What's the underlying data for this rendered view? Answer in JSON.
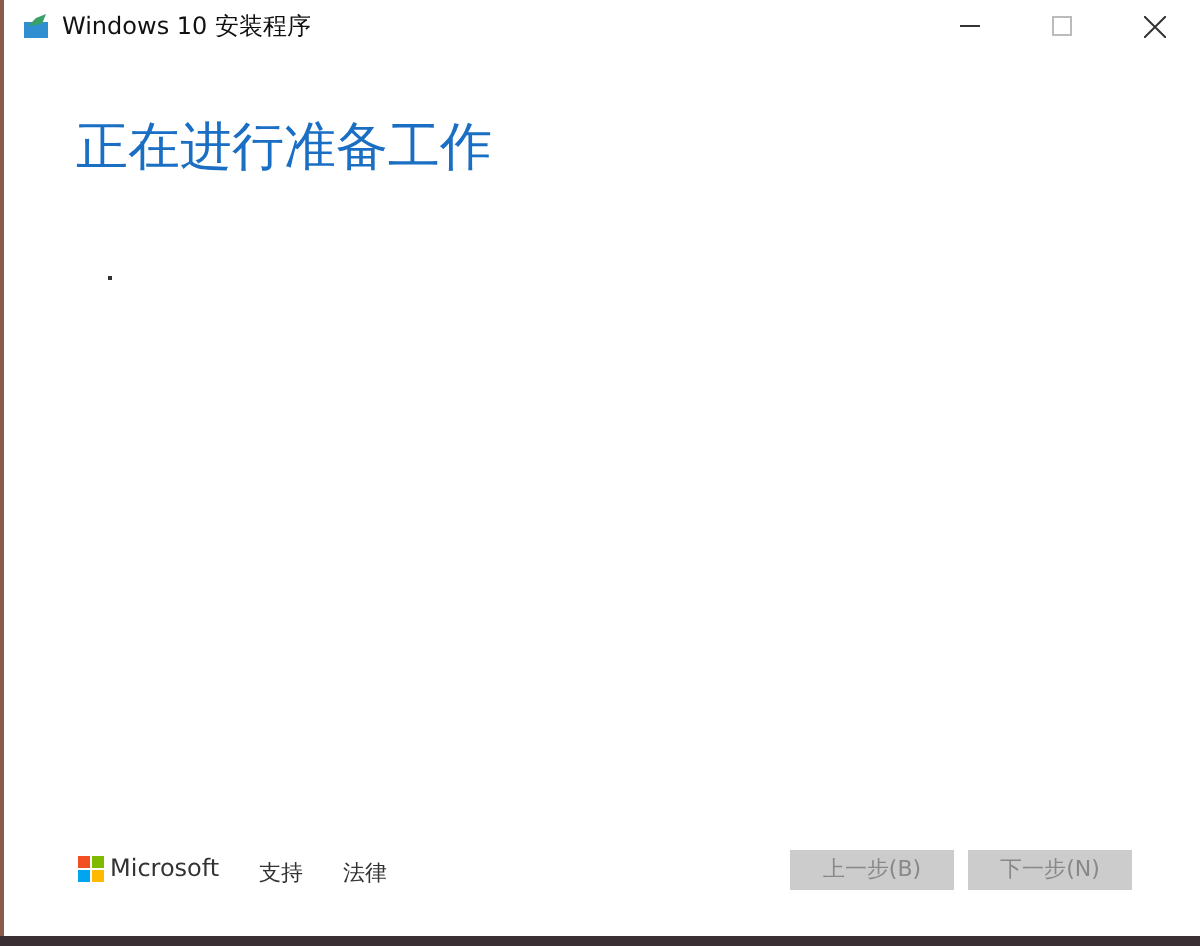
{
  "window": {
    "title": "Windows 10 安装程序"
  },
  "heading": "正在进行准备工作",
  "footer": {
    "brand": "Microsoft",
    "links": [
      "支持",
      "法律"
    ],
    "buttons": [
      {
        "label": "上一步(B)",
        "disabled": true
      },
      {
        "label": "下一步(N)",
        "disabled": true
      }
    ]
  }
}
